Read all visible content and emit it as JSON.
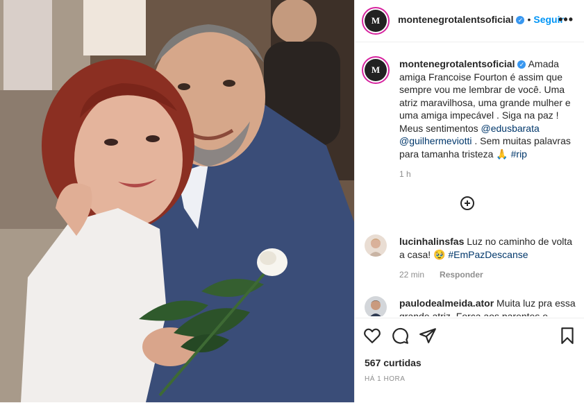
{
  "post": {
    "author": "montenegrotalentsoficial",
    "follow_label": "Seguir",
    "more_label": "•••",
    "avatar_letter": "M",
    "caption_author": "montenegrotalentsoficial",
    "caption_parts": [
      "Amada amiga Francoise Fourton é assim que sempre vou me lembrar de você. Uma atriz maravilhosa, uma grande mulher e uma amiga impecável . Siga na paz ! Meus sentimentos ",
      "@edusbarata",
      " ",
      "@guilhermeviotti",
      " . Sem muitas palavras para tamanha tristeza 🙏 ",
      "#rip"
    ],
    "caption_time": "1 h",
    "likes": "567 curtidas",
    "time_ago": "HÁ 1 HORA"
  },
  "comments": [
    {
      "user": "lucinhalinsfas",
      "text_before": "Luz no caminho de volta a casa! 🥹 ",
      "hashtag": "#EmPazDescanse",
      "time": "22 min",
      "reply_label": "Responder"
    },
    {
      "user": "paulodealmeida.ator",
      "text": "Muita luz pra essa grande atriz. Força aos parentes e"
    }
  ],
  "icons": {
    "like": "heart-icon",
    "comment": "comment-icon",
    "share": "paper-plane-icon",
    "save": "bookmark-icon",
    "load_more": "plus-circle-icon"
  },
  "colors": {
    "link_blue": "#0095f6",
    "mention": "#00376b",
    "muted": "#8e8e8e",
    "verified": "#3897f0"
  }
}
